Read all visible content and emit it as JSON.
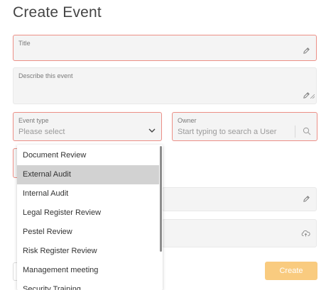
{
  "page": {
    "title": "Create Event"
  },
  "form": {
    "title_label": "Title",
    "description_label": "Describe this event",
    "event_type_label": "Event type",
    "event_type_value": "Please select",
    "owner_label": "Owner",
    "owner_placeholder": "Start typing to search a User",
    "create_label": "Create"
  },
  "dropdown": {
    "selected_index": 1,
    "options": [
      "Document Review",
      "External Audit",
      "Internal Audit",
      "Legal Register Review",
      "Pestel Review",
      "Risk Register Review",
      "Management meeting",
      "Security Training"
    ]
  },
  "colors": {
    "required_border": "#ec8f86",
    "create_button": "#f9cb7f",
    "selected_option": "#d2d2d2"
  },
  "icons": [
    "pencil-icon",
    "chevron-down-icon",
    "search-icon",
    "upload-cloud-icon",
    "resize-handle-icon"
  ]
}
